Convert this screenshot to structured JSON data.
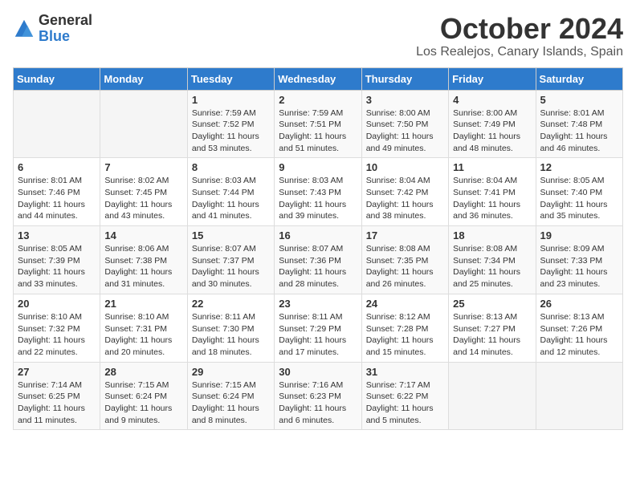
{
  "header": {
    "logo_general": "General",
    "logo_blue": "Blue",
    "month": "October 2024",
    "location": "Los Realejos, Canary Islands, Spain"
  },
  "days_of_week": [
    "Sunday",
    "Monday",
    "Tuesday",
    "Wednesday",
    "Thursday",
    "Friday",
    "Saturday"
  ],
  "weeks": [
    [
      {
        "day": "",
        "info": ""
      },
      {
        "day": "",
        "info": ""
      },
      {
        "day": "1",
        "info": "Sunrise: 7:59 AM\nSunset: 7:52 PM\nDaylight: 11 hours and 53 minutes."
      },
      {
        "day": "2",
        "info": "Sunrise: 7:59 AM\nSunset: 7:51 PM\nDaylight: 11 hours and 51 minutes."
      },
      {
        "day": "3",
        "info": "Sunrise: 8:00 AM\nSunset: 7:50 PM\nDaylight: 11 hours and 49 minutes."
      },
      {
        "day": "4",
        "info": "Sunrise: 8:00 AM\nSunset: 7:49 PM\nDaylight: 11 hours and 48 minutes."
      },
      {
        "day": "5",
        "info": "Sunrise: 8:01 AM\nSunset: 7:48 PM\nDaylight: 11 hours and 46 minutes."
      }
    ],
    [
      {
        "day": "6",
        "info": "Sunrise: 8:01 AM\nSunset: 7:46 PM\nDaylight: 11 hours and 44 minutes."
      },
      {
        "day": "7",
        "info": "Sunrise: 8:02 AM\nSunset: 7:45 PM\nDaylight: 11 hours and 43 minutes."
      },
      {
        "day": "8",
        "info": "Sunrise: 8:03 AM\nSunset: 7:44 PM\nDaylight: 11 hours and 41 minutes."
      },
      {
        "day": "9",
        "info": "Sunrise: 8:03 AM\nSunset: 7:43 PM\nDaylight: 11 hours and 39 minutes."
      },
      {
        "day": "10",
        "info": "Sunrise: 8:04 AM\nSunset: 7:42 PM\nDaylight: 11 hours and 38 minutes."
      },
      {
        "day": "11",
        "info": "Sunrise: 8:04 AM\nSunset: 7:41 PM\nDaylight: 11 hours and 36 minutes."
      },
      {
        "day": "12",
        "info": "Sunrise: 8:05 AM\nSunset: 7:40 PM\nDaylight: 11 hours and 35 minutes."
      }
    ],
    [
      {
        "day": "13",
        "info": "Sunrise: 8:05 AM\nSunset: 7:39 PM\nDaylight: 11 hours and 33 minutes."
      },
      {
        "day": "14",
        "info": "Sunrise: 8:06 AM\nSunset: 7:38 PM\nDaylight: 11 hours and 31 minutes."
      },
      {
        "day": "15",
        "info": "Sunrise: 8:07 AM\nSunset: 7:37 PM\nDaylight: 11 hours and 30 minutes."
      },
      {
        "day": "16",
        "info": "Sunrise: 8:07 AM\nSunset: 7:36 PM\nDaylight: 11 hours and 28 minutes."
      },
      {
        "day": "17",
        "info": "Sunrise: 8:08 AM\nSunset: 7:35 PM\nDaylight: 11 hours and 26 minutes."
      },
      {
        "day": "18",
        "info": "Sunrise: 8:08 AM\nSunset: 7:34 PM\nDaylight: 11 hours and 25 minutes."
      },
      {
        "day": "19",
        "info": "Sunrise: 8:09 AM\nSunset: 7:33 PM\nDaylight: 11 hours and 23 minutes."
      }
    ],
    [
      {
        "day": "20",
        "info": "Sunrise: 8:10 AM\nSunset: 7:32 PM\nDaylight: 11 hours and 22 minutes."
      },
      {
        "day": "21",
        "info": "Sunrise: 8:10 AM\nSunset: 7:31 PM\nDaylight: 11 hours and 20 minutes."
      },
      {
        "day": "22",
        "info": "Sunrise: 8:11 AM\nSunset: 7:30 PM\nDaylight: 11 hours and 18 minutes."
      },
      {
        "day": "23",
        "info": "Sunrise: 8:11 AM\nSunset: 7:29 PM\nDaylight: 11 hours and 17 minutes."
      },
      {
        "day": "24",
        "info": "Sunrise: 8:12 AM\nSunset: 7:28 PM\nDaylight: 11 hours and 15 minutes."
      },
      {
        "day": "25",
        "info": "Sunrise: 8:13 AM\nSunset: 7:27 PM\nDaylight: 11 hours and 14 minutes."
      },
      {
        "day": "26",
        "info": "Sunrise: 8:13 AM\nSunset: 7:26 PM\nDaylight: 11 hours and 12 minutes."
      }
    ],
    [
      {
        "day": "27",
        "info": "Sunrise: 7:14 AM\nSunset: 6:25 PM\nDaylight: 11 hours and 11 minutes."
      },
      {
        "day": "28",
        "info": "Sunrise: 7:15 AM\nSunset: 6:24 PM\nDaylight: 11 hours and 9 minutes."
      },
      {
        "day": "29",
        "info": "Sunrise: 7:15 AM\nSunset: 6:24 PM\nDaylight: 11 hours and 8 minutes."
      },
      {
        "day": "30",
        "info": "Sunrise: 7:16 AM\nSunset: 6:23 PM\nDaylight: 11 hours and 6 minutes."
      },
      {
        "day": "31",
        "info": "Sunrise: 7:17 AM\nSunset: 6:22 PM\nDaylight: 11 hours and 5 minutes."
      },
      {
        "day": "",
        "info": ""
      },
      {
        "day": "",
        "info": ""
      }
    ]
  ]
}
